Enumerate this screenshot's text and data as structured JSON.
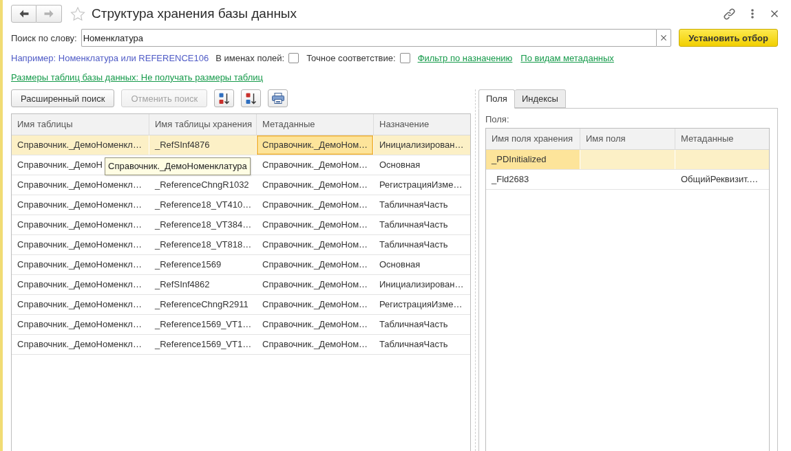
{
  "window": {
    "title": "Структура хранения базы данных",
    "favorite": false
  },
  "navigation": {
    "back_disabled": false,
    "forward_disabled": true
  },
  "search": {
    "label": "Поиск по слову:",
    "value": "Номенклатура"
  },
  "apply_button": "Установить отбор",
  "hint": "Например: Номенклатура или REFERENCE106",
  "options": [
    {
      "label": "В именах полей:",
      "checked": false
    },
    {
      "label": "Точное соответствие:",
      "checked": false
    }
  ],
  "links": [
    "Фильтр по назначению",
    "По видам метаданных"
  ],
  "table_sizes_link": "Размеры таблиц базы данных: Не получать размеры таблиц",
  "toolbar": [
    {
      "kind": "text",
      "label": "Расширенный поиск",
      "disabled": false
    },
    {
      "kind": "text",
      "label": "Отменить поиск",
      "disabled": true
    },
    {
      "kind": "sort_ascending",
      "disabled": false
    },
    {
      "kind": "sort_descending",
      "disabled": false
    },
    {
      "kind": "print",
      "disabled": false
    }
  ],
  "tables_grid": {
    "columns": [
      "Имя таблицы",
      "Имя таблицы хранения",
      "Метаданные",
      "Назначение"
    ],
    "rows": [
      {
        "selected": true,
        "cells": [
          {
            "text": "Справочник._ДемоНоменкл…",
            "focused": false
          },
          {
            "text": "_RefSInf4876",
            "focused": false
          },
          {
            "text": "Справочник._ДемоНом…",
            "focused": true
          },
          {
            "text": "Инициализирован…",
            "focused": false
          }
        ]
      },
      {
        "selected": false,
        "cells": [
          {
            "text": "Справочник._ДемоН",
            "focused": false
          },
          {
            "focused": false
          },
          {
            "text": "Справочник._ДемоНом…",
            "focused": false
          },
          {
            "text": "Основная",
            "focused": false
          }
        ]
      },
      {
        "selected": false,
        "cells": [
          {
            "text": "Справочник._ДемоНоменкл…",
            "focused": false
          },
          {
            "text": "_ReferenceChngR1032",
            "focused": false
          },
          {
            "text": "Справочник._ДемоНом…",
            "focused": false
          },
          {
            "text": "РегистрацияИзме…",
            "focused": false
          }
        ]
      },
      {
        "selected": false,
        "cells": [
          {
            "text": "Справочник._ДемоНоменкл…",
            "focused": false
          },
          {
            "text": "_Reference18_VT410…",
            "focused": false
          },
          {
            "text": "Справочник._ДемоНом…",
            "focused": false
          },
          {
            "text": "ТабличнаяЧасть",
            "focused": false
          }
        ]
      },
      {
        "selected": false,
        "cells": [
          {
            "text": "Справочник._ДемоНоменкл…",
            "focused": false
          },
          {
            "text": "_Reference18_VT384…",
            "focused": false
          },
          {
            "text": "Справочник._ДемоНом…",
            "focused": false
          },
          {
            "text": "ТабличнаяЧасть",
            "focused": false
          }
        ]
      },
      {
        "selected": false,
        "cells": [
          {
            "text": "Справочник._ДемоНоменкл…",
            "focused": false
          },
          {
            "text": "_Reference18_VT818…",
            "focused": false
          },
          {
            "text": "Справочник._ДемоНом…",
            "focused": false
          },
          {
            "text": "ТабличнаяЧасть",
            "focused": false
          }
        ]
      },
      {
        "selected": false,
        "cells": [
          {
            "text": "Справочник._ДемоНоменкл…",
            "focused": false
          },
          {
            "text": "_Reference1569",
            "focused": false
          },
          {
            "text": "Справочник._ДемоНом…",
            "focused": false
          },
          {
            "text": "Основная",
            "focused": false
          }
        ]
      },
      {
        "selected": false,
        "cells": [
          {
            "text": "Справочник._ДемоНоменкл…",
            "focused": false
          },
          {
            "text": "_RefSInf4862",
            "focused": false
          },
          {
            "text": "Справочник._ДемоНом…",
            "focused": false
          },
          {
            "text": "Инициализирован…",
            "focused": false
          }
        ]
      },
      {
        "selected": false,
        "cells": [
          {
            "text": "Справочник._ДемоНоменкл…",
            "focused": false
          },
          {
            "text": "_ReferenceChngR2911",
            "focused": false
          },
          {
            "text": "Справочник._ДемоНом…",
            "focused": false
          },
          {
            "text": "РегистрацияИзме…",
            "focused": false
          }
        ]
      },
      {
        "selected": false,
        "cells": [
          {
            "text": "Справочник._ДемоНоменкл…",
            "focused": false
          },
          {
            "text": "_Reference1569_VT1…",
            "focused": false
          },
          {
            "text": "Справочник._ДемоНом…",
            "focused": false
          },
          {
            "text": "ТабличнаяЧасть",
            "focused": false
          }
        ]
      },
      {
        "selected": false,
        "cells": [
          {
            "text": "Справочник._ДемоНоменкл…",
            "focused": false
          },
          {
            "text": "_Reference1569_VT1…",
            "focused": false
          },
          {
            "text": "Справочник._ДемоНом…",
            "focused": false
          },
          {
            "text": "ТабличнаяЧасть",
            "focused": false
          }
        ]
      }
    ],
    "tooltip": "Справочник._ДемоНоменклатура"
  },
  "details_panel": {
    "tabs": [
      {
        "label": "Поля",
        "selected": true
      },
      {
        "label": "Индексы",
        "selected": false
      }
    ],
    "fields_label": "Поля:",
    "fields_grid": {
      "columns": [
        "Имя поля хранения",
        "Имя поля",
        "Метаданные"
      ],
      "rows": [
        {
          "selected": true,
          "cells": [
            {
              "text": "_PDInitialized",
              "focused": true
            },
            {
              "focused": false
            },
            {
              "focused": false
            }
          ]
        },
        {
          "selected": false,
          "cells": [
            {
              "text": "_Fld2683",
              "focused": false
            },
            {
              "focused": false
            },
            {
              "text": "ОбщийРеквизит.…",
              "focused": false
            }
          ]
        }
      ]
    }
  }
}
